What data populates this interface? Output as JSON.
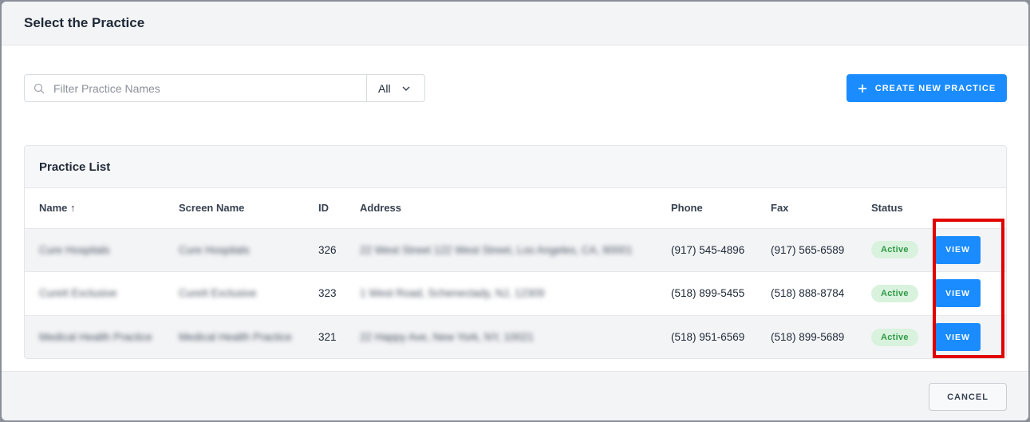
{
  "modal": {
    "title": "Select the Practice"
  },
  "toolbar": {
    "search_placeholder": "Filter Practice Names",
    "filter_value": "All",
    "create_label": "CREATE NEW PRACTICE"
  },
  "panel": {
    "title": "Practice List",
    "columns": [
      "Name",
      "Screen Name",
      "ID",
      "Address",
      "Phone",
      "Fax",
      "Status"
    ],
    "sort_indicator": "↑",
    "rows": [
      {
        "name": "Cure Hospitals",
        "screen_name": "Cure Hospitals",
        "id": "326",
        "address": "22 West Street 122 West Street, Los Angeles, CA, 90001",
        "phone": "(917) 545-4896",
        "fax": "(917) 565-6589",
        "status": "Active",
        "action": "VIEW"
      },
      {
        "name": "CureIt Exclusive",
        "screen_name": "CureIt Exclusive",
        "id": "323",
        "address": "1 West Road, Schenectady, NJ, 12309",
        "phone": "(518) 899-5455",
        "fax": "(518) 888-8784",
        "status": "Active",
        "action": "VIEW"
      },
      {
        "name": "Medical Health Practice",
        "screen_name": "Medical Health Practice",
        "id": "321",
        "address": "22 Happy Ave, New York, NY, 10021",
        "phone": "(518) 951-6569",
        "fax": "(518) 899-5689",
        "status": "Active",
        "action": "VIEW"
      }
    ]
  },
  "footer": {
    "cancel_label": "CANCEL"
  },
  "colors": {
    "primary": "#1a8cff",
    "status_active_bg": "#d9f2dd",
    "status_active_text": "#2f9a47",
    "highlight": "#e00000"
  }
}
